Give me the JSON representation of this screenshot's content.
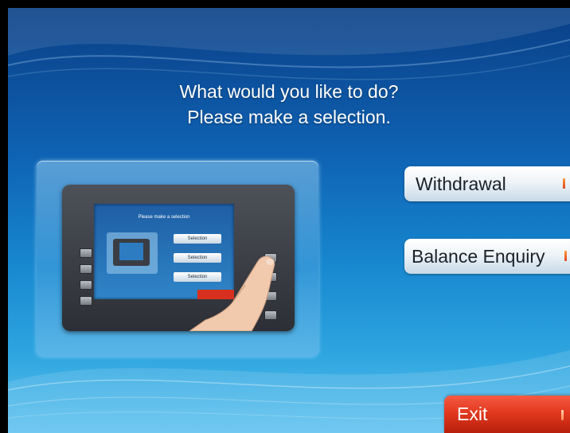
{
  "prompt": {
    "line1": "What would you like to do?",
    "line2": "Please make a selection."
  },
  "illustration": {
    "screen_title": "Please make a selection",
    "buttons": [
      "Selection",
      "Selection",
      "Selection"
    ]
  },
  "options": [
    {
      "label": "Withdrawal"
    },
    {
      "label": "Balance Enquiry"
    }
  ],
  "exit": {
    "label": "Exit"
  },
  "colors": {
    "background_top": "#0a3f86",
    "background_bottom": "#5ec2ef",
    "option_button": "#eef4f8",
    "exit_button": "#e23a20",
    "marker": "#e0421d"
  }
}
